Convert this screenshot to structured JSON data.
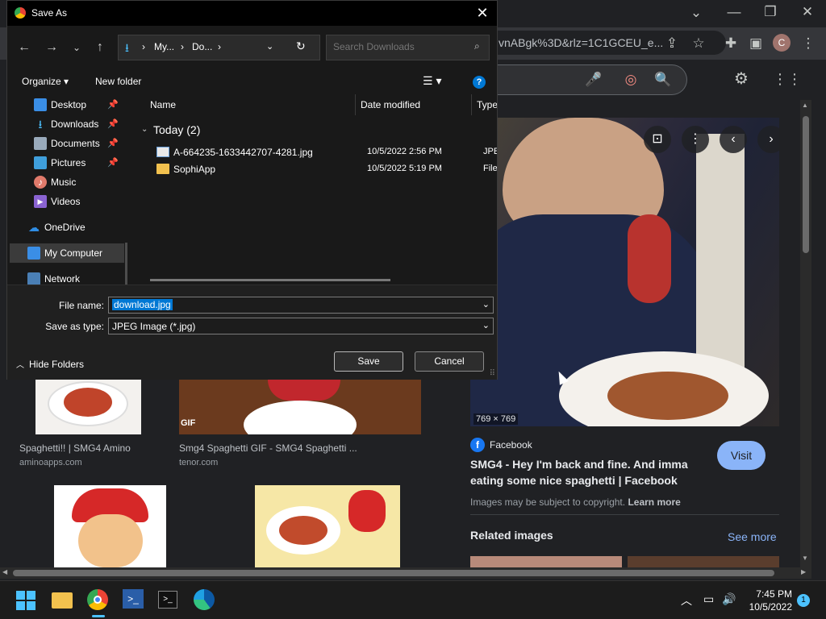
{
  "browser": {
    "url_fragment": "vnABgk%3D&rlz=1C1GCEU_e...",
    "profile_initial": "C",
    "preview": {
      "dimensions": "769 × 769",
      "source_name": "Facebook",
      "visit_label": "Visit",
      "title": "SMG4 - Hey I'm back and fine. And imma eating some nice spaghetti | Facebook",
      "copyright_text": "Images may be subject to copyright.",
      "learn_more": "Learn more",
      "related_label": "Related images",
      "see_more": "See more"
    },
    "results": [
      {
        "title": "Spaghetti!! | SMG4 Amino",
        "site": "aminoapps.com"
      },
      {
        "title": "Smg4 Spaghetti GIF - SMG4 Spaghetti ...",
        "site": "tenor.com",
        "badge": "GIF"
      }
    ]
  },
  "dialog": {
    "title": "Save As",
    "breadcrumb": [
      "My...",
      "Do..."
    ],
    "search_placeholder": "Search Downloads",
    "organize_label": "Organize",
    "new_folder_label": "New folder",
    "nav_items": [
      {
        "label": "Desktop",
        "icon": "desktop-icon",
        "pinned": true
      },
      {
        "label": "Downloads",
        "icon": "download-icon",
        "pinned": true
      },
      {
        "label": "Documents",
        "icon": "documents-icon",
        "pinned": true
      },
      {
        "label": "Pictures",
        "icon": "pictures-icon",
        "pinned": true
      },
      {
        "label": "Music",
        "icon": "music-icon",
        "pinned": false
      },
      {
        "label": "Videos",
        "icon": "videos-icon",
        "pinned": false
      },
      {
        "label": "OneDrive",
        "icon": "cloud-icon",
        "pinned": false
      },
      {
        "label": "My Computer",
        "icon": "computer-icon",
        "pinned": false
      },
      {
        "label": "Network",
        "icon": "network-icon",
        "pinned": false
      }
    ],
    "columns": [
      "Name",
      "Date modified",
      "Type"
    ],
    "group_label": "Today (2)",
    "files": [
      {
        "name": "A-664235-1633442707-4281.jpg",
        "date": "10/5/2022 2:56 PM",
        "type": "JPEG",
        "icon": "image-file-icon"
      },
      {
        "name": "SophiApp",
        "date": "10/5/2022 5:19 PM",
        "type": "File f",
        "icon": "folder-icon"
      }
    ],
    "file_name_label": "File name:",
    "file_name_value": "download.jpg",
    "save_type_label": "Save as type:",
    "save_type_value": "JPEG Image (*.jpg)",
    "hide_folders_label": "Hide Folders",
    "save_label": "Save",
    "cancel_label": "Cancel"
  },
  "taskbar": {
    "time": "7:45 PM",
    "date": "10/5/2022",
    "notification_count": "1"
  },
  "colors": {
    "accent": "#0078d4",
    "google_blue": "#8ab4f8",
    "facebook": "#1877f2"
  }
}
